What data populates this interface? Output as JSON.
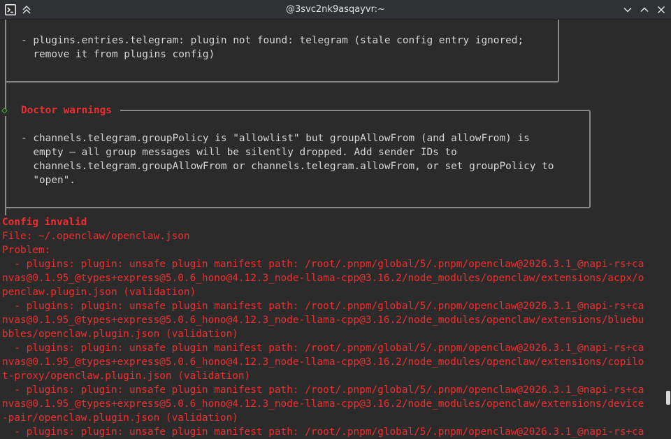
{
  "window": {
    "title": "@3svc2nk9asqayvr:~",
    "app_icon": "terminal-app-icon",
    "keep_above_icon": "double-chevron-up-icon",
    "minimize_icon": "chevron-down-icon",
    "maximize_icon": "chevron-up-icon",
    "close_icon": "close-icon"
  },
  "box1": {
    "line1": "- plugins.entries.telegram: plugin not found: telegram (stale config entry ignored;",
    "line2": "  remove it from plugins config)"
  },
  "box2": {
    "marker": "◇",
    "title": "Doctor warnings",
    "line1": "- channels.telegram.groupPolicy is \"allowlist\" but groupAllowFrom (and allowFrom) is",
    "line2": "  empty — all group messages will be silently dropped. Add sender IDs to",
    "line3": "  channels.telegram.groupAllowFrom or channels.telegram.allowFrom, or set groupPolicy to",
    "line4": "  \"open\"."
  },
  "error": {
    "heading": "Config invalid",
    "file": "File: ~/.openclaw/openclaw.json",
    "problem": "Problem:",
    "lines": [
      "  - plugins: plugin: unsafe plugin manifest path: /root/.pnpm/global/5/.pnpm/openclaw@2026.3.1_@napi-rs+ca",
      "nvas@0.1.95_@types+express@5.0.6_hono@4.12.3_node-llama-cpp@3.16.2/node_modules/openclaw/extensions/acpx/o",
      "penclaw.plugin.json (validation)",
      "  - plugins: plugin: unsafe plugin manifest path: /root/.pnpm/global/5/.pnpm/openclaw@2026.3.1_@napi-rs+ca",
      "nvas@0.1.95_@types+express@5.0.6_hono@4.12.3_node-llama-cpp@3.16.2/node_modules/openclaw/extensions/bluebu",
      "bbles/openclaw.plugin.json (validation)",
      "  - plugins: plugin: unsafe plugin manifest path: /root/.pnpm/global/5/.pnpm/openclaw@2026.3.1_@napi-rs+ca",
      "nvas@0.1.95_@types+express@5.0.6_hono@4.12.3_node-llama-cpp@3.16.2/node_modules/openclaw/extensions/copilo",
      "t-proxy/openclaw.plugin.json (validation)",
      "  - plugins: plugin: unsafe plugin manifest path: /root/.pnpm/global/5/.pnpm/openclaw@2026.3.1_@napi-rs+ca",
      "nvas@0.1.95_@types+express@5.0.6_hono@4.12.3_node-llama-cpp@3.16.2/node_modules/openclaw/extensions/device",
      "-pair/openclaw.plugin.json (validation)",
      "  - plugins: plugin: unsafe plugin manifest path: /root/.pnpm/global/5/.pnpm/openclaw@2026.3.1_@napi-rs+ca"
    ]
  },
  "colors": {
    "background": "#2b2b2b",
    "text": "#d6d6d6",
    "error": "#ef2f2f",
    "frame": "#8a8a8a",
    "marker": "#3fbf3f"
  }
}
